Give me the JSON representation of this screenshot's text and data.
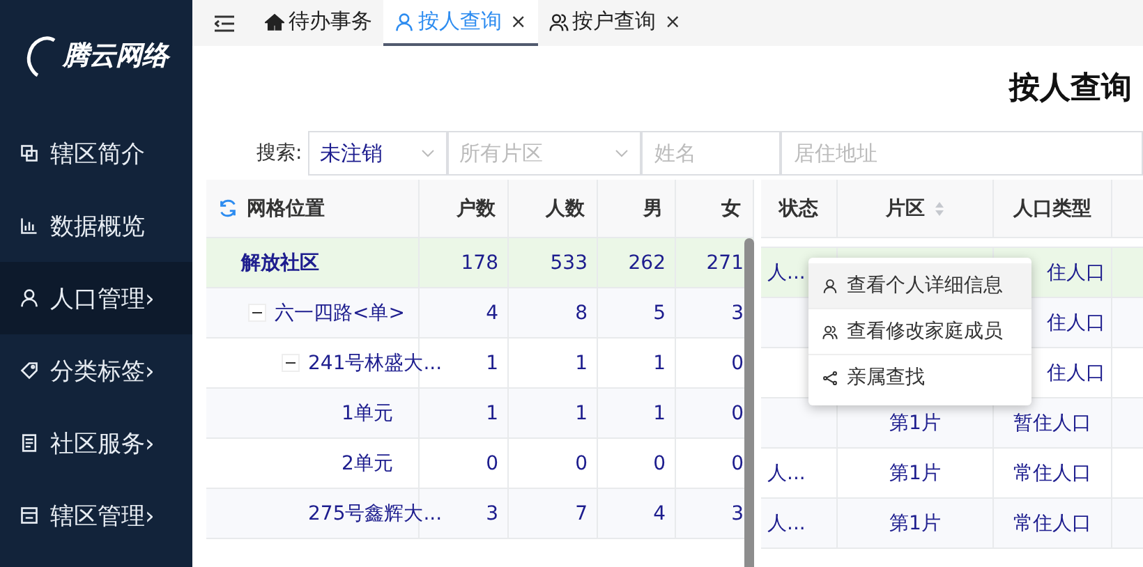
{
  "sidebar": {
    "logo": "腾云网络",
    "items": [
      {
        "label": "辖区简介",
        "selected": false
      },
      {
        "label": "数据概览",
        "selected": false
      },
      {
        "label": "人口管理›",
        "selected": true
      },
      {
        "label": "分类标签›",
        "selected": false
      },
      {
        "label": "社区服务›",
        "selected": false
      },
      {
        "label": "辖区管理›",
        "selected": false
      }
    ]
  },
  "tabs": [
    {
      "label": "待办事务",
      "selected": false
    },
    {
      "label": "按人查询",
      "close": "×",
      "selected": true
    },
    {
      "label": "按户查询",
      "close": "×",
      "selected": false
    }
  ],
  "page_title": "按人查询",
  "search": {
    "label": "搜索:",
    "fields": [
      {
        "kind": "select",
        "value": "未注销"
      },
      {
        "kind": "select",
        "placeholder": "所有片区"
      },
      {
        "kind": "input",
        "placeholder": "姓名"
      },
      {
        "kind": "input",
        "placeholder": "居住地址"
      }
    ]
  },
  "grid_table": {
    "columns": [
      "网格位置",
      "户数",
      "人数",
      "男",
      "女"
    ],
    "rows": [
      {
        "cells": [
          "解放社区",
          "178",
          "533",
          "262",
          "271"
        ],
        "selected": true,
        "children": [
          {
            "cells": [
              "六一四路<单>",
              "4",
              "8",
              "5",
              "3"
            ],
            "selected": false,
            "expanded": true,
            "children": [
              {
                "cells": [
                  "241号林盛大...",
                  "1",
                  "1",
                  "1",
                  "0"
                ],
                "selected": false,
                "expanded": true,
                "children": [
                  {
                    "cells": [
                      "1单元",
                      "1",
                      "1",
                      "1",
                      "0"
                    ],
                    "selected": false
                  },
                  {
                    "cells": [
                      "2单元",
                      "0",
                      "0",
                      "0",
                      "0"
                    ],
                    "selected": false
                  }
                ]
              },
              {
                "cells": [
                  "275号鑫辉大...",
                  "3",
                  "7",
                  "4",
                  "3"
                ],
                "selected": false
              }
            ]
          }
        ]
      }
    ]
  },
  "person_table": {
    "columns": [
      "状态",
      "片区",
      "人口类型"
    ],
    "rows": [
      {
        "cells": [
          "人...",
          "",
          "住人口"
        ],
        "selected": true
      },
      {
        "cells": [
          "",
          "",
          "住人口"
        ],
        "selected": false
      },
      {
        "cells": [
          "",
          "",
          "住人口"
        ],
        "selected": false
      },
      {
        "cells": [
          "",
          "第1片",
          "暂住人口"
        ],
        "selected": false
      },
      {
        "cells": [
          "人...",
          "第1片",
          "常住人口"
        ],
        "selected": false
      },
      {
        "cells": [
          "人...",
          "第1片",
          "常住人口"
        ],
        "selected": false
      }
    ]
  },
  "context_menu": [
    {
      "label": "查看个人详细信息",
      "selected": true
    },
    {
      "label": "查看修改家庭成员",
      "selected": false
    },
    {
      "label": "亲属查找",
      "selected": false
    }
  ]
}
